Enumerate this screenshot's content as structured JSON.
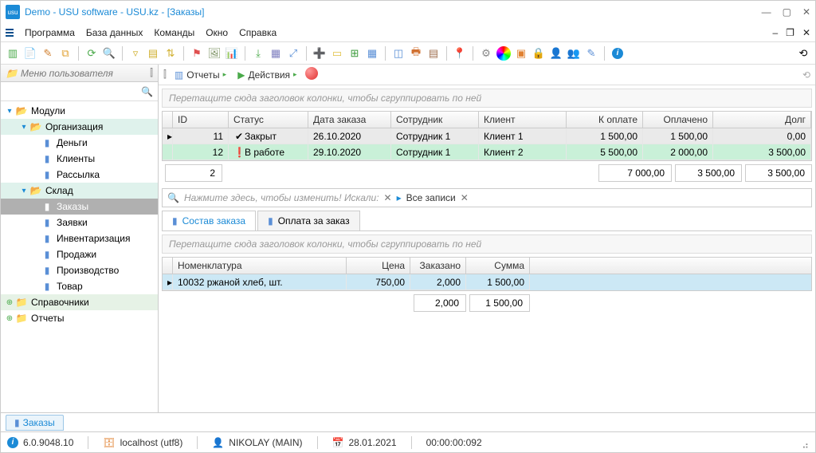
{
  "title": "Demo - USU software - USU.kz - [Заказы]",
  "menu": [
    "Программа",
    "База данных",
    "Команды",
    "Окно",
    "Справка"
  ],
  "sidebar": {
    "header": "Меню пользователя",
    "items": [
      {
        "label": "Модули"
      },
      {
        "label": "Организация"
      },
      {
        "label": "Деньги"
      },
      {
        "label": "Клиенты"
      },
      {
        "label": "Рассылка"
      },
      {
        "label": "Склад"
      },
      {
        "label": "Заказы"
      },
      {
        "label": "Заявки"
      },
      {
        "label": "Инвентаризация"
      },
      {
        "label": "Продажи"
      },
      {
        "label": "Производство"
      },
      {
        "label": "Товар"
      },
      {
        "label": "Справочники"
      },
      {
        "label": "Отчеты"
      }
    ]
  },
  "content_toolbar": {
    "reports": "Отчеты",
    "actions": "Действия"
  },
  "group_hint": "Перетащите сюда заголовок колонки, чтобы сгруппировать по ней",
  "orders": {
    "columns": [
      "ID",
      "Статус",
      "Дата заказа",
      "Сотрудник",
      "Клиент",
      "К оплате",
      "Оплачено",
      "Долг"
    ],
    "rows": [
      {
        "id": "11",
        "status": "Закрыт",
        "date": "26.10.2020",
        "emp": "Сотрудник 1",
        "client": "Клиент 1",
        "due": "1 500,00",
        "paid": "1 500,00",
        "debt": "0,00"
      },
      {
        "id": "12",
        "status": "В работе",
        "date": "29.10.2020",
        "emp": "Сотрудник 1",
        "client": "Клиент 2",
        "due": "5 500,00",
        "paid": "2 000,00",
        "debt": "3 500,00"
      }
    ],
    "footer": {
      "count": "2",
      "due": "7 000,00",
      "paid": "3 500,00",
      "debt": "3 500,00"
    }
  },
  "search": {
    "hint": "Нажмите здесь, чтобы изменить! Искали:",
    "all": "Все записи"
  },
  "detail_tabs": [
    "Состав заказа",
    "Оплата за заказ"
  ],
  "detail": {
    "columns": [
      "Номенклатура",
      "Цена",
      "Заказано",
      "Сумма"
    ],
    "row": {
      "name": "10032 ржаной хлеб, шт.",
      "price": "750,00",
      "qty": "2,000",
      "sum": "1 500,00"
    },
    "footer": {
      "qty": "2,000",
      "sum": "1 500,00"
    }
  },
  "bottom_tab": "Заказы",
  "status": {
    "version": "6.0.9048.10",
    "host": "localhost (utf8)",
    "user": "NIKOLAY (MAIN)",
    "date": "28.01.2021",
    "time": "00:00:00:092"
  }
}
